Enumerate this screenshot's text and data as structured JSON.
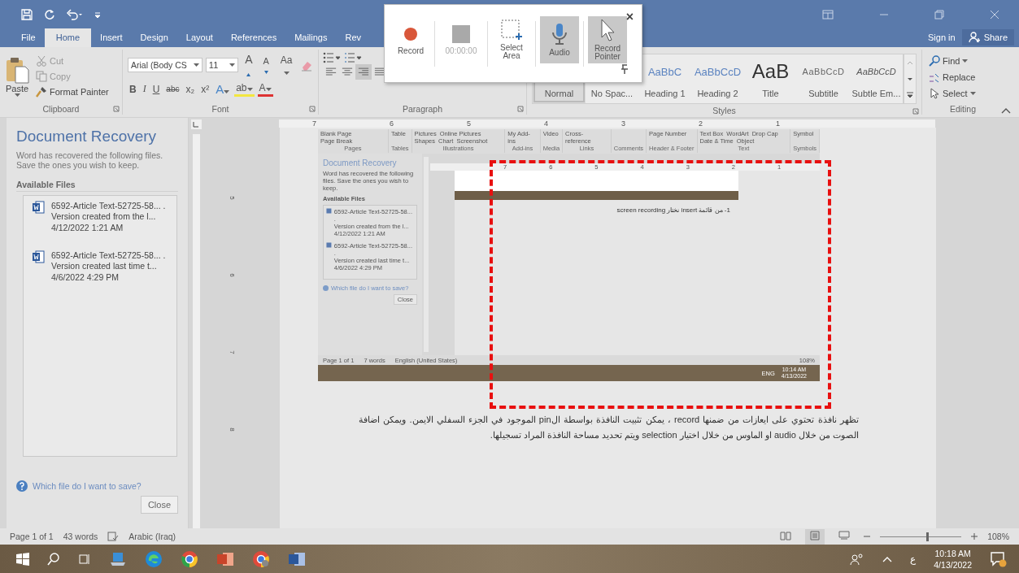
{
  "tabs": [
    {
      "label": "File",
      "selected": false
    },
    {
      "label": "Home",
      "selected": true
    },
    {
      "label": "Insert",
      "selected": false
    },
    {
      "label": "Design",
      "selected": false
    },
    {
      "label": "Layout",
      "selected": false
    },
    {
      "label": "References",
      "selected": false
    },
    {
      "label": "Mailings",
      "selected": false
    },
    {
      "label": "Rev",
      "selected": false
    }
  ],
  "account": {
    "sign_in": "Sign in",
    "share": "Share"
  },
  "clipboard": {
    "paste": "Paste",
    "cut": "Cut",
    "copy": "Copy",
    "format_painter": "Format Painter",
    "label": "Clipboard"
  },
  "font": {
    "name": "Arial (Body CS",
    "size": "11",
    "grow": "A",
    "shrink": "A",
    "change_case": "Aa",
    "format_buttons": [
      "B",
      "I",
      "U",
      "abc",
      "x₂",
      "x²"
    ],
    "text_effects": "A",
    "highlight": "ab",
    "font_color": "A",
    "label": "Font"
  },
  "paragraph": {
    "align_buttons": [
      {
        "kind": "left",
        "selected": false
      },
      {
        "kind": "center",
        "selected": false
      },
      {
        "kind": "right",
        "selected": true
      },
      {
        "kind": "justify",
        "selected": false
      }
    ],
    "label": "Paragraph"
  },
  "styles": {
    "items": [
      {
        "name": "Normal",
        "selected": true
      },
      {
        "name": "No Spac...",
        "selected": false
      },
      {
        "preview": "AaBbC",
        "name": "Heading 1",
        "selected": false
      },
      {
        "preview": "AaBbCcD",
        "name": "Heading 2",
        "selected": false
      },
      {
        "preview": "AaB",
        "name": "Title",
        "selected": false
      },
      {
        "preview": "AaBbCcD",
        "name": "Subtitle",
        "selected": false
      },
      {
        "preview": "AaBbCcD",
        "name": "Subtle Em...",
        "selected": false
      }
    ],
    "label": "Styles"
  },
  "editing": {
    "find": "Find",
    "replace": "Replace",
    "select": "Select",
    "label": "Editing"
  },
  "recorder": {
    "buttons": [
      {
        "kind": "record",
        "label": "Record",
        "selected": false
      },
      {
        "kind": "timer",
        "label": "00:00:00",
        "selected": false
      },
      {
        "kind": "area",
        "label": "Select Area",
        "selected": false
      },
      {
        "kind": "audio",
        "label": "Audio",
        "selected": true
      },
      {
        "kind": "pointer",
        "label": "Record Pointer",
        "selected": true
      }
    ],
    "close": "×"
  },
  "recovery": {
    "title": "Document Recovery",
    "description": "Word has recovered the following files. Save the ones you wish to keep.",
    "available_label": "Available Files",
    "files": [
      {
        "name": "6592-Article Text-52725-58... .",
        "version": "Version created from the l...",
        "date": "4/12/2022 1:21 AM"
      },
      {
        "name": "6592-Article Text-52725-58... .",
        "version": "Version created last time t...",
        "date": "4/6/2022 4:29 PM"
      }
    ],
    "help_link": "Which file do I want to save?",
    "close": "Close"
  },
  "horizontal_ruler": [
    "7",
    "6",
    "5",
    "4",
    "3",
    "2",
    "1"
  ],
  "vertical_ruler": [
    "5",
    "6",
    "7",
    "8"
  ],
  "document": {
    "screenshot": {
      "ribbon_groups": [
        {
          "label": "Pages",
          "buttons": [
            "Blank Page",
            "Page Break"
          ]
        },
        {
          "label": "Tables",
          "buttons": [
            "Table"
          ]
        },
        {
          "label": "Illustrations",
          "buttons": [
            "Pictures",
            "Online Pictures",
            "Shapes",
            "Chart",
            "Screenshot"
          ]
        },
        {
          "label": "Add-ins",
          "buttons": [
            "My Add-ins"
          ]
        },
        {
          "label": "Media",
          "buttons": [
            "Video"
          ]
        },
        {
          "label": "Links",
          "buttons": [
            "Cross-reference"
          ]
        },
        {
          "label": "Comments"
        },
        {
          "label": "Header & Footer",
          "buttons": [
            "Page Number"
          ]
        },
        {
          "label": "Text",
          "buttons": [
            "Text Box",
            "WordArt",
            "Drop Cap",
            "Date & Time",
            "Object"
          ]
        },
        {
          "label": "Symbols",
          "buttons": [
            "Symbol"
          ]
        }
      ],
      "recovery": {
        "title": "Document Recovery",
        "description": "Word has recovered the following files. Save the ones you wish to keep.",
        "available_label": "Available Files",
        "files": [
          {
            "name": "6592-Article Text-52725-58... .",
            "version": "Version created from the l...",
            "date": "4/12/2022 1:21 AM"
          },
          {
            "name": "6592-Article Text-52725-58... .",
            "version": "Version created last time t...",
            "date": "4/6/2022 4:29 PM"
          }
        ],
        "help_link": "Which file do I want to save?",
        "close": "Close"
      },
      "ruler": [
        "7",
        "6",
        "5",
        "4",
        "3",
        "2",
        "1"
      ],
      "line": "1- من قائمة insert نختار screen recording",
      "status": {
        "page": "Page 1 of 1",
        "words": "7 words",
        "language": "English (United States)",
        "zoom": "108%"
      },
      "taskbar": {
        "language": "ENG",
        "time": "10:14 AM",
        "date": "4/13/2022"
      }
    },
    "paragraph": "تظهر نافذة تحتوي على ايعازات من ضمنها record ، يمكن تثبيت النافذة بواسطة الpin الموجود في الجزء السفلي الايمن. ويمكن اضافة الصوت من خلال audio او الماوس من خلال اختيار selection ويتم تحديد مساحة النافذة المراد تسجيلها."
  },
  "status_bar": {
    "page": "Page 1 of 1",
    "words": "43 words",
    "language": "Arabic (Iraq)",
    "views": [
      {
        "kind": "read",
        "selected": false
      },
      {
        "kind": "print",
        "selected": true
      },
      {
        "kind": "web",
        "selected": false
      }
    ],
    "zoom": {
      "level": 0.58,
      "reading": "108%"
    }
  },
  "taskbar": {
    "input_language": "ع",
    "time": "10:18 AM",
    "date": "4/13/2022"
  }
}
